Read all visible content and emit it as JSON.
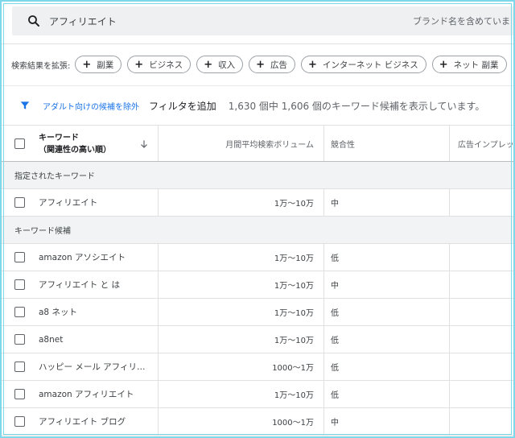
{
  "search": {
    "value": "アフィリエイト",
    "right_text": "ブランド名を含めていま"
  },
  "expand": {
    "label": "検索結果を拡張:",
    "chips": [
      "副業",
      "ビジネス",
      "収入",
      "広告",
      "インターネット ビジネス",
      "ネット 副業"
    ]
  },
  "filter": {
    "chip_label": "アダルト向けの候補を除外",
    "add_filter": "フィルタを追加",
    "result_count": "1,630 個中 1,606 個のキーワード候補を表示しています。"
  },
  "table": {
    "headers": {
      "keyword": "キーワード",
      "keyword_sub": "（関連性の高い順）",
      "volume": "月間平均検索ボリューム",
      "competition": "競合性",
      "impression": "広告インプレッ"
    },
    "sections": [
      {
        "title": "指定されたキーワード",
        "rows": [
          {
            "keyword": "アフィリエイト",
            "volume": "1万～10万",
            "competition": "中"
          }
        ]
      },
      {
        "title": "キーワード候補",
        "rows": [
          {
            "keyword": "amazon アソシエイト",
            "volume": "1万～10万",
            "competition": "低"
          },
          {
            "keyword": "アフィリエイト と は",
            "volume": "1万～10万",
            "competition": "中"
          },
          {
            "keyword": "a8 ネット",
            "volume": "1万～10万",
            "competition": "低"
          },
          {
            "keyword": "a8net",
            "volume": "1万～10万",
            "competition": "低"
          },
          {
            "keyword": "ハッピー メール アフィリエ...",
            "volume": "1000～1万",
            "competition": "低"
          },
          {
            "keyword": "amazon アフィリエイト",
            "volume": "1万～10万",
            "competition": "低"
          },
          {
            "keyword": "アフィリエイト ブログ",
            "volume": "1000～1万",
            "competition": "中"
          }
        ]
      }
    ]
  },
  "colors": {
    "accent": "#1a73e8",
    "frame": "#7fd8ea",
    "section_bg": "#f1f3f4"
  }
}
